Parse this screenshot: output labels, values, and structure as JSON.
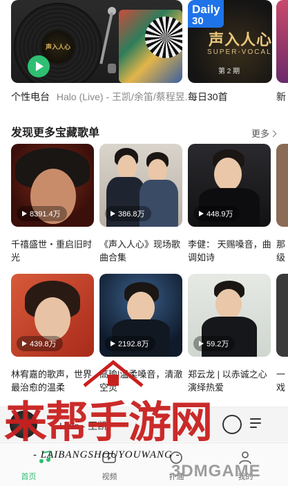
{
  "top_cards": [
    {
      "caption_title": "个性电台",
      "caption_detail": "Halo (Live) - 王凯/余笛/蔡程昱...",
      "cover_text": "声入人心"
    },
    {
      "caption_title": "每日30首",
      "badge_line1": "Daily",
      "badge_line2": "30",
      "cover_title": "声入人心",
      "cover_sub": "SUPER-VOCAL",
      "cover_issue": "第 2 期"
    },
    {
      "caption_title": "新"
    }
  ],
  "section": {
    "title": "发现更多宝藏歌单",
    "more_label": "更多"
  },
  "playlists": [
    {
      "count": "8391.4万",
      "title": "千禧盛世・重启旧时光"
    },
    {
      "count": "386.8万",
      "title": "《声入人心》现场歌曲合集"
    },
    {
      "count": "448.9万",
      "title": "李健： 天赐嗓音，曲调如诗"
    },
    {
      "count": "",
      "title": "那级"
    },
    {
      "count": "439.8万",
      "title": "林宥嘉的歌声，世界最治愈的温柔"
    },
    {
      "count": "2192.8万",
      "title": "高瑜|温柔嗓音，清澈空灵"
    },
    {
      "count": "59.2万",
      "title": "郑云龙 | 以赤诚之心演绎热爱"
    },
    {
      "count": "",
      "title": "一戏"
    }
  ],
  "player": {
    "text": "Halo - 王凯"
  },
  "tabs": [
    {
      "label": "首页",
      "icon": "music-note-icon",
      "active": true
    },
    {
      "label": "视频",
      "icon": "video-icon",
      "active": false
    },
    {
      "label": "扑通",
      "icon": "social-icon",
      "active": false
    },
    {
      "label": "",
      "icon": "community-icon",
      "active": false
    },
    {
      "label": "我的",
      "icon": "profile-icon",
      "active": false
    }
  ],
  "watermark": {
    "main": "来帮手游网",
    "sub": "- LAIBANGSHOUYOUWANG -",
    "site": "3DMGAME"
  },
  "colors": {
    "accent": "#2fbf72",
    "watermark_red": "#c8201f",
    "daily_blue": "#1f73e8"
  }
}
